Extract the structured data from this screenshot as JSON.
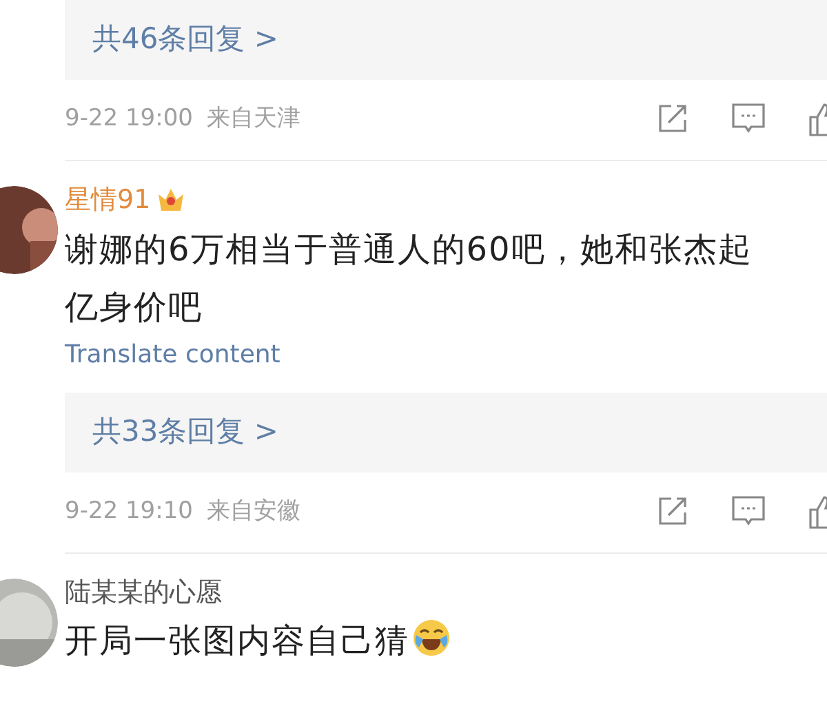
{
  "blocks": [
    {
      "kind": "replies",
      "label": "共46条回复 >"
    },
    {
      "kind": "meta",
      "time": "9-22 19:00",
      "source": "来自天津"
    },
    {
      "kind": "comment",
      "author": "星情91",
      "vip": true,
      "lines": [
        "谢娜的6万相当于普通人的60吧，她和张杰起",
        "亿身价吧"
      ],
      "trailing_emoji": false,
      "translate": "Translate content"
    },
    {
      "kind": "replies",
      "label": "共33条回复 >"
    },
    {
      "kind": "meta",
      "time": "9-22 19:10",
      "source": "来自安徽"
    },
    {
      "kind": "comment",
      "author": "陆某某的心愿",
      "vip": false,
      "lines": [
        "开局一张图内容自己猜"
      ],
      "trailing_emoji": true
    }
  ]
}
